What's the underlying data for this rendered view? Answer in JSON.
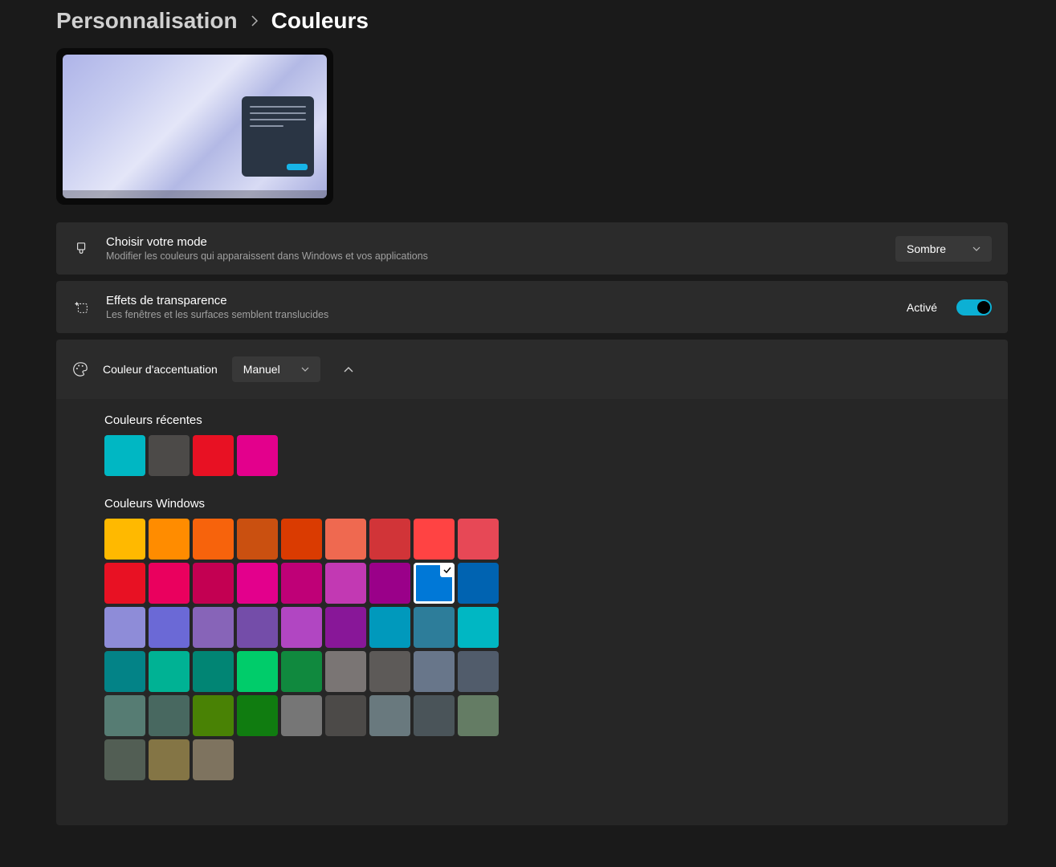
{
  "breadcrumb": {
    "parent": "Personnalisation",
    "current": "Couleurs"
  },
  "rows": {
    "mode": {
      "title": "Choisir votre mode",
      "subtitle": "Modifier les couleurs qui apparaissent dans Windows et vos applications",
      "value": "Sombre"
    },
    "transparency": {
      "title": "Effets de transparence",
      "subtitle": "Les fenêtres et les surfaces semblent translucides",
      "state_label": "Activé",
      "enabled": true
    },
    "accent": {
      "title": "Couleur d'accentuation",
      "value": "Manuel"
    }
  },
  "sections": {
    "recent_label": "Couleurs récentes",
    "windows_label": "Couleurs Windows"
  },
  "recent_colors": [
    "#00b7c3",
    "#4c4a48",
    "#e81123",
    "#e3008c"
  ],
  "windows_colors": [
    {
      "hex": "#ffb900"
    },
    {
      "hex": "#ff8c00"
    },
    {
      "hex": "#f7630c"
    },
    {
      "hex": "#ca5010"
    },
    {
      "hex": "#da3b01"
    },
    {
      "hex": "#ef6950"
    },
    {
      "hex": "#d13438"
    },
    {
      "hex": "#ff4343"
    },
    {
      "hex": "#e74856"
    },
    {
      "hex": "#e81123"
    },
    {
      "hex": "#ea005e"
    },
    {
      "hex": "#c30052"
    },
    {
      "hex": "#e3008c"
    },
    {
      "hex": "#bf0077"
    },
    {
      "hex": "#c239b3"
    },
    {
      "hex": "#9a0089"
    },
    {
      "hex": "#0078d7",
      "selected": true
    },
    {
      "hex": "#0063b1"
    },
    {
      "hex": "#8e8cd8"
    },
    {
      "hex": "#6b69d6"
    },
    {
      "hex": "#8764b8"
    },
    {
      "hex": "#744da9"
    },
    {
      "hex": "#b146c2"
    },
    {
      "hex": "#881798"
    },
    {
      "hex": "#0099bc"
    },
    {
      "hex": "#2d7d9a"
    },
    {
      "hex": "#00b7c3"
    },
    {
      "hex": "#038387"
    },
    {
      "hex": "#00b294"
    },
    {
      "hex": "#018574"
    },
    {
      "hex": "#00cc6a"
    },
    {
      "hex": "#10893e"
    },
    {
      "hex": "#7a7574"
    },
    {
      "hex": "#5d5a58"
    },
    {
      "hex": "#68768a"
    },
    {
      "hex": "#515c6b"
    },
    {
      "hex": "#567c73"
    },
    {
      "hex": "#486860"
    },
    {
      "hex": "#498205"
    },
    {
      "hex": "#107c10"
    },
    {
      "hex": "#767676"
    },
    {
      "hex": "#4c4a48"
    },
    {
      "hex": "#69797e"
    },
    {
      "hex": "#4a5459"
    },
    {
      "hex": "#647c64"
    },
    {
      "hex": "#525e54"
    },
    {
      "hex": "#847545"
    },
    {
      "hex": "#7e735f"
    }
  ]
}
